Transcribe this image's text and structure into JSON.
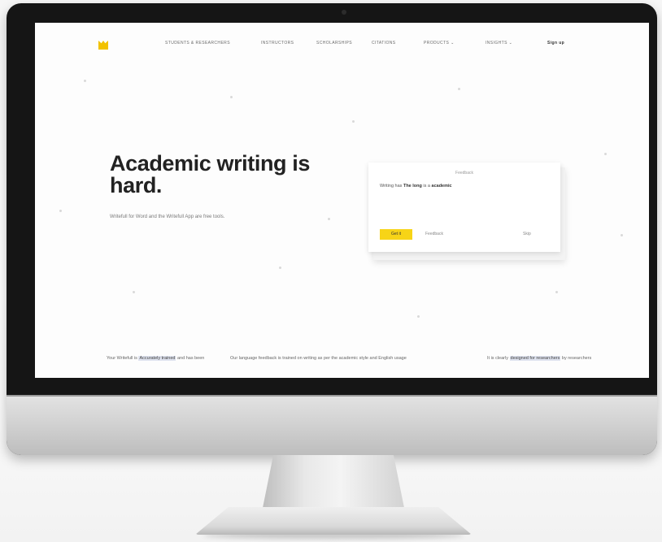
{
  "nav": {
    "items": [
      "Students & Researchers",
      "Instructors",
      "Scholarships",
      "Citations",
      "Products",
      "Insights"
    ],
    "signup_label": "Sign up"
  },
  "hero": {
    "headline": "Academic writing is hard.",
    "subtitle": "Writefull for Word and the Writefull App are free tools."
  },
  "card": {
    "title": "Feedback",
    "text_parts": [
      "Writing has",
      "The long",
      "is",
      "a",
      "academic"
    ],
    "button_label": "Get it",
    "link_label": "Feedback",
    "link2_label": "Skip"
  },
  "columns": [
    {
      "text_plain": "Your Writefull is",
      "highlight": "Accurately trained",
      "text_after": "and has been"
    },
    {
      "text_plain": "Our language feedback is trained on writing as per the academic style and English usage",
      "highlight": "",
      "text_after": ""
    },
    {
      "text_plain": "It is clearly",
      "highlight": "designed for researchers",
      "text_after": "by researchers"
    }
  ],
  "colors": {
    "accent": "#f7d417",
    "logo": "#f2c200",
    "bezel": "#151515"
  }
}
